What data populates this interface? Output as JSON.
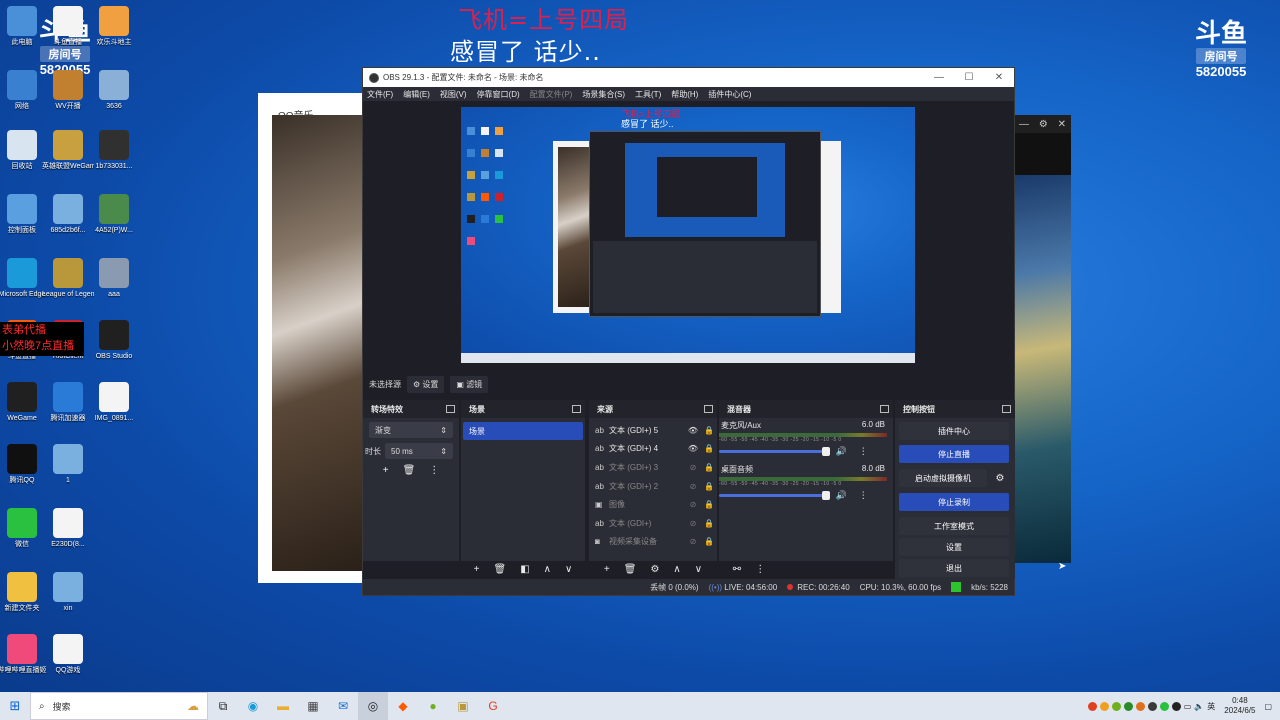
{
  "overlay": {
    "title": "飞机=上号四局",
    "subtitle": "感冒了  话少..",
    "red_banner_line1": "表弟代播",
    "red_banner_line2": "小然晚7点直播",
    "douyu_left": {
      "brand": "斗鱼",
      "room_label": "房间号",
      "room_number": "5820055"
    },
    "douyu_right": {
      "brand": "斗鱼",
      "room_label": "房间号",
      "room_number": "5820055"
    }
  },
  "desktop_icons": [
    {
      "label": "此电脑",
      "icon": "computer-icon",
      "color": "#4a90d8"
    },
    {
      "label": "斗鱼直播",
      "icon": "file-icon",
      "color": "#f4f4f4"
    },
    {
      "label": "欢乐斗地主",
      "icon": "game-icon",
      "color": "#f0a040"
    },
    {
      "label": "网络",
      "icon": "network-icon",
      "color": "#3a80d0"
    },
    {
      "label": "WV开播",
      "icon": "app-icon",
      "color": "#c08030"
    },
    {
      "label": "3636",
      "icon": "app-icon",
      "color": "#8ab0d8"
    },
    {
      "label": "回收站",
      "icon": "recycle-bin-icon",
      "color": "#d8e4f0"
    },
    {
      "label": "英雄联盟WeGame版",
      "icon": "lol-icon",
      "color": "#c8a040"
    },
    {
      "label": "1b733031...",
      "icon": "app-icon",
      "color": "#303030"
    },
    {
      "label": "控制面板",
      "icon": "control-panel-icon",
      "color": "#5aa0e0"
    },
    {
      "label": "685d2b6f...",
      "icon": "image-icon",
      "color": "#7ab0e0"
    },
    {
      "label": "4A52(P)W...",
      "icon": "app-icon",
      "color": "#4a8a4a"
    },
    {
      "label": "Microsoft Edge",
      "icon": "edge-icon",
      "color": "#1a9ad8"
    },
    {
      "label": "League of Legends",
      "icon": "lol-icon",
      "color": "#b8983a"
    },
    {
      "label": "aaa",
      "icon": "image-icon",
      "color": "#8a9ab0"
    },
    {
      "label": "斗鱼直播",
      "icon": "douyu-icon",
      "color": "#ff5a00"
    },
    {
      "label": "RiotClient",
      "icon": "riot-icon",
      "color": "#d0202a"
    },
    {
      "label": "OBS Studio",
      "icon": "obs-icon",
      "color": "#202020"
    },
    {
      "label": "WeGame",
      "icon": "wegame-icon",
      "color": "#202020"
    },
    {
      "label": "腾讯加速器",
      "icon": "accelerator-icon",
      "color": "#2a7ad8"
    },
    {
      "label": "IMG_0891...",
      "icon": "qr-icon",
      "color": "#f4f4f4"
    },
    {
      "label": "腾讯QQ",
      "icon": "qq-icon",
      "color": "#101010"
    },
    {
      "label": "1",
      "icon": "image-icon",
      "color": "#7ab0e0"
    },
    {
      "label": "微信",
      "icon": "wechat-icon",
      "color": "#2ac040"
    },
    {
      "label": "E230D(8...",
      "icon": "qr-icon",
      "color": "#f4f4f4"
    },
    {
      "label": "新建文件夹",
      "icon": "folder-icon",
      "color": "#f0c040"
    },
    {
      "label": "xin",
      "icon": "image-icon",
      "color": "#7ab0e0"
    },
    {
      "label": "哔哩哔哩直播姬",
      "icon": "bili-icon",
      "color": "#f04a7a"
    },
    {
      "label": "QQ游戏",
      "icon": "qq-game-icon",
      "color": "#f4f4f4"
    }
  ],
  "qq_window": {
    "title": "QQ音乐"
  },
  "obs": {
    "title": "OBS 29.1.3 - 配置文件: 未命名 - 场景: 未命名",
    "menu": [
      {
        "label": "文件(F)",
        "dim": false
      },
      {
        "label": "编辑(E)",
        "dim": false
      },
      {
        "label": "视图(V)",
        "dim": false
      },
      {
        "label": "停靠窗口(D)",
        "dim": false
      },
      {
        "label": "配置文件(P)",
        "dim": true
      },
      {
        "label": "场景集合(S)",
        "dim": false
      },
      {
        "label": "工具(T)",
        "dim": false
      },
      {
        "label": "帮助(H)",
        "dim": false
      },
      {
        "label": "插件中心(C)",
        "dim": false
      }
    ],
    "preview_overlay": {
      "title": "飞机=上号四局",
      "subtitle": "感冒了  话少.."
    },
    "scene_bar": {
      "no_selection": "未选择源",
      "settings": "设置",
      "filters": "滤镜"
    },
    "transitions": {
      "header": "转场特效",
      "type": "渐变",
      "duration_label": "时长",
      "duration_value": "50 ms"
    },
    "scenes": {
      "header": "场景",
      "items": [
        "场景"
      ]
    },
    "sources": {
      "header": "来源",
      "items": [
        {
          "name": "文本 (GDI+) 5",
          "icon": "text-icon",
          "visible": true
        },
        {
          "name": "文本 (GDI+) 4",
          "icon": "text-icon",
          "visible": true
        },
        {
          "name": "文本 (GDI+) 3",
          "icon": "text-icon",
          "visible": false
        },
        {
          "name": "文本 (GDI+) 2",
          "icon": "text-icon",
          "visible": false
        },
        {
          "name": "图像",
          "icon": "image-icon",
          "visible": false
        },
        {
          "name": "文本 (GDI+)",
          "icon": "text-icon",
          "visible": false
        },
        {
          "name": "视频采集设备",
          "icon": "camera-icon",
          "visible": false
        }
      ]
    },
    "mixer": {
      "header": "混音器",
      "ticks": "-60 -55 -50 -45 -40 -35 -30 -25 -20 -15 -10 -5 0",
      "channels": [
        {
          "name": "麦克风/Aux",
          "db": "6.0 dB",
          "volume": 0.92
        },
        {
          "name": "桌面音频",
          "db": "8.0 dB",
          "volume": 0.92
        }
      ]
    },
    "controls": {
      "header": "控制按钮",
      "plugin_center": "插件中心",
      "stop_stream": "停止直播",
      "start_virtual_cam": "启动虚拟摄像机",
      "stop_record": "停止录制",
      "studio_mode": "工作室模式",
      "settings": "设置",
      "exit": "退出"
    },
    "status": {
      "dropped": "丢帧 0 (0.0%)",
      "live": "LIVE: 04:56:00",
      "rec": "REC: 00:26:40",
      "cpu": "CPU: 10.3%, 60.00 fps",
      "bitrate": "kb/s: 5228"
    }
  },
  "taskbar": {
    "search_placeholder": "搜索",
    "ime": "英",
    "time": "0:48",
    "date": "2024/6/5"
  }
}
